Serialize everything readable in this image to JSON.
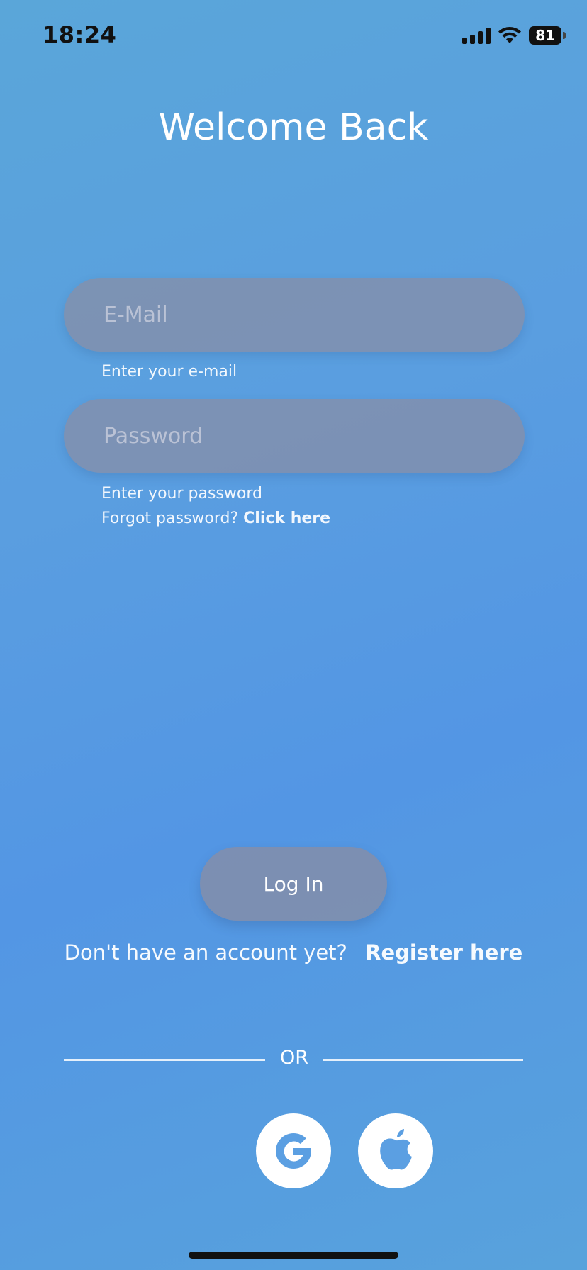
{
  "status_bar": {
    "time": "18:24",
    "battery_level": "81",
    "icons": [
      "cellular-signal-icon",
      "wifi-icon",
      "battery-icon"
    ]
  },
  "header": {
    "title": "Welcome Back"
  },
  "form": {
    "email": {
      "placeholder": "E-Mail",
      "value": "",
      "helper": "Enter your e-mail"
    },
    "password": {
      "placeholder": "Password",
      "value": "",
      "helper": "Enter your password"
    },
    "forgot": {
      "prompt": "Forgot password?",
      "link": "Click here"
    },
    "login_label": "Log In"
  },
  "register": {
    "prompt": "Don't have an account yet?",
    "link": "Register here"
  },
  "divider": {
    "label": "OR"
  },
  "social": {
    "google_icon": "google-icon",
    "apple_icon": "apple-icon"
  },
  "colors": {
    "background_start": "#5aa6d9",
    "background_end": "#5396e4",
    "input_fill": "#8c8ca0",
    "text": "#ffffff"
  }
}
